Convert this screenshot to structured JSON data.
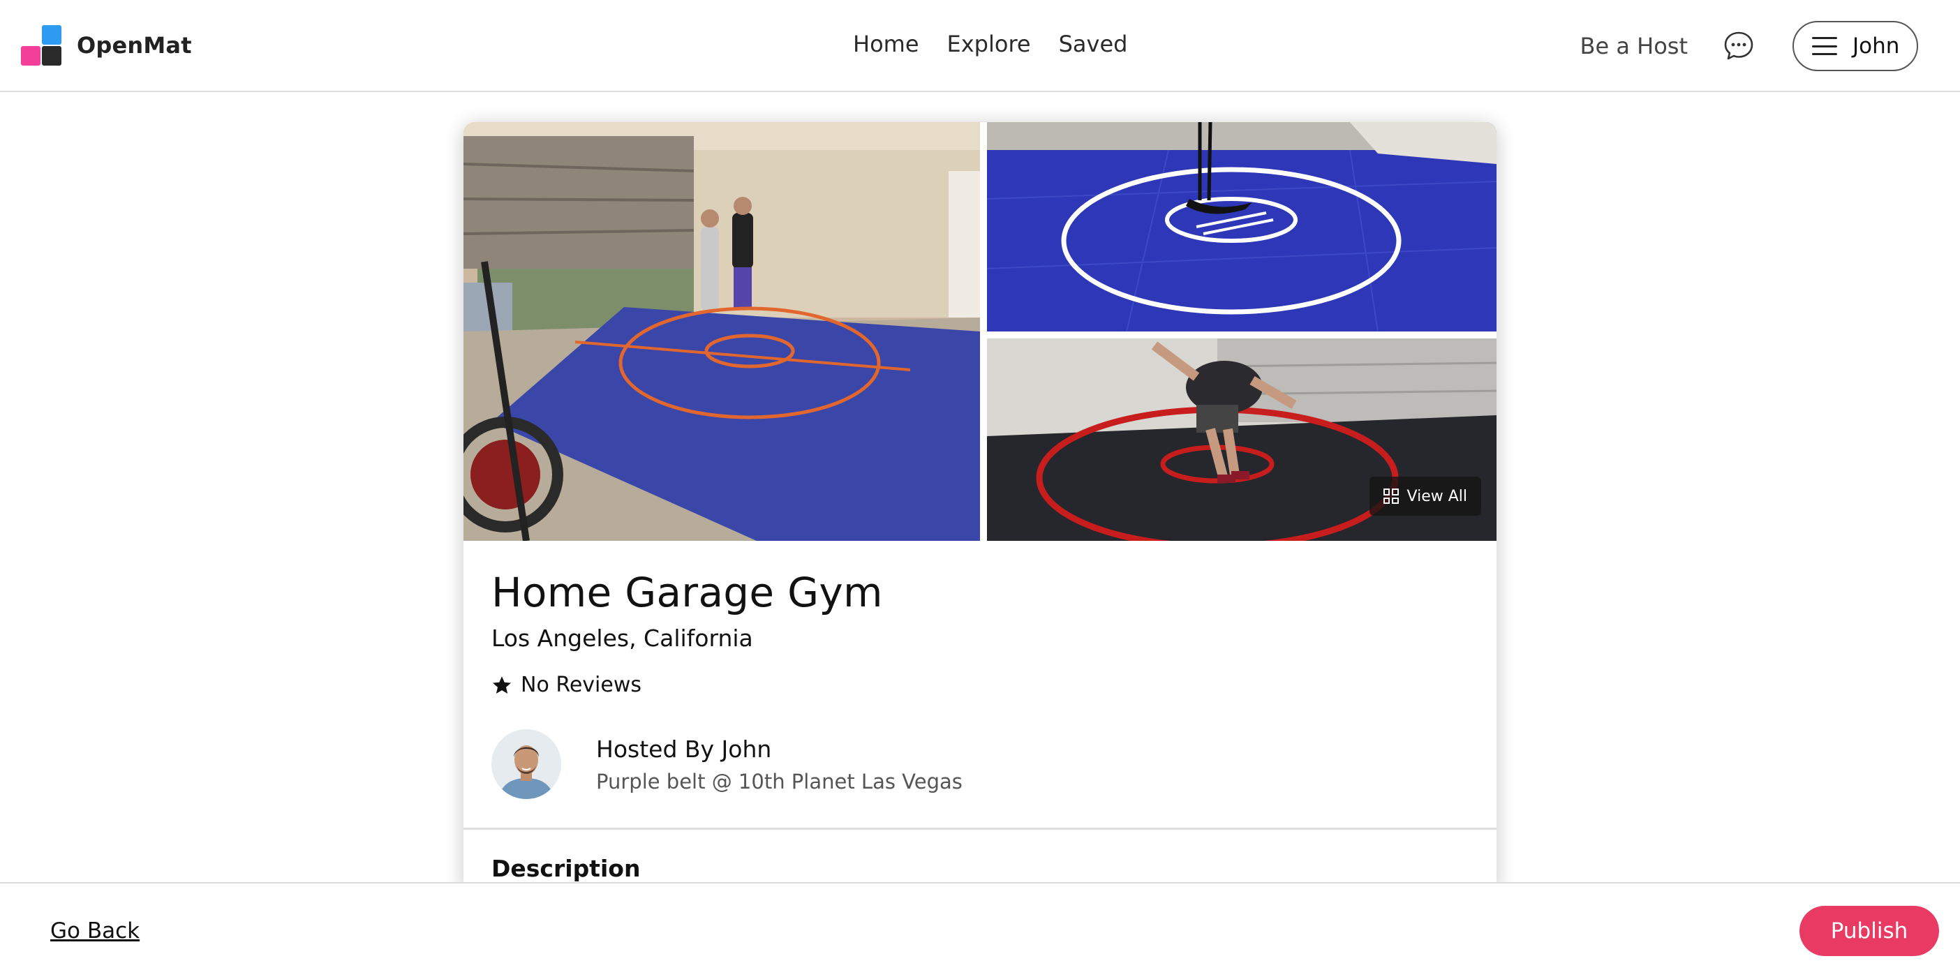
{
  "brand": {
    "name": "OpenMat",
    "colors": {
      "blue": "#2d9bf0",
      "pink": "#f43f9a",
      "dark": "#2a2a2a"
    }
  },
  "nav": {
    "items": [
      "Home",
      "Explore",
      "Saved"
    ]
  },
  "header": {
    "host_link": "Be a Host",
    "message_icon": "chat-bubble-icon",
    "menu_icon": "hamburger-menu-icon",
    "user_name": "John"
  },
  "gallery": {
    "images": [
      "garage-gym-blue-mat-photo",
      "blue-wrestling-mat-photo",
      "wrestlers-black-mat-photo"
    ],
    "view_all_label": "View All",
    "view_all_icon": "grid-icon"
  },
  "listing": {
    "title": "Home Garage Gym",
    "location": "Los Angeles, California",
    "rating_icon": "star-icon",
    "reviews": "No Reviews"
  },
  "host": {
    "name": "Hosted By John",
    "subtitle": "Purple belt @ 10th Planet Las Vegas"
  },
  "sections": {
    "description_title": "Description"
  },
  "footer": {
    "back_label": "Go Back",
    "publish_label": "Publish",
    "publish_color": "#e83a63"
  }
}
